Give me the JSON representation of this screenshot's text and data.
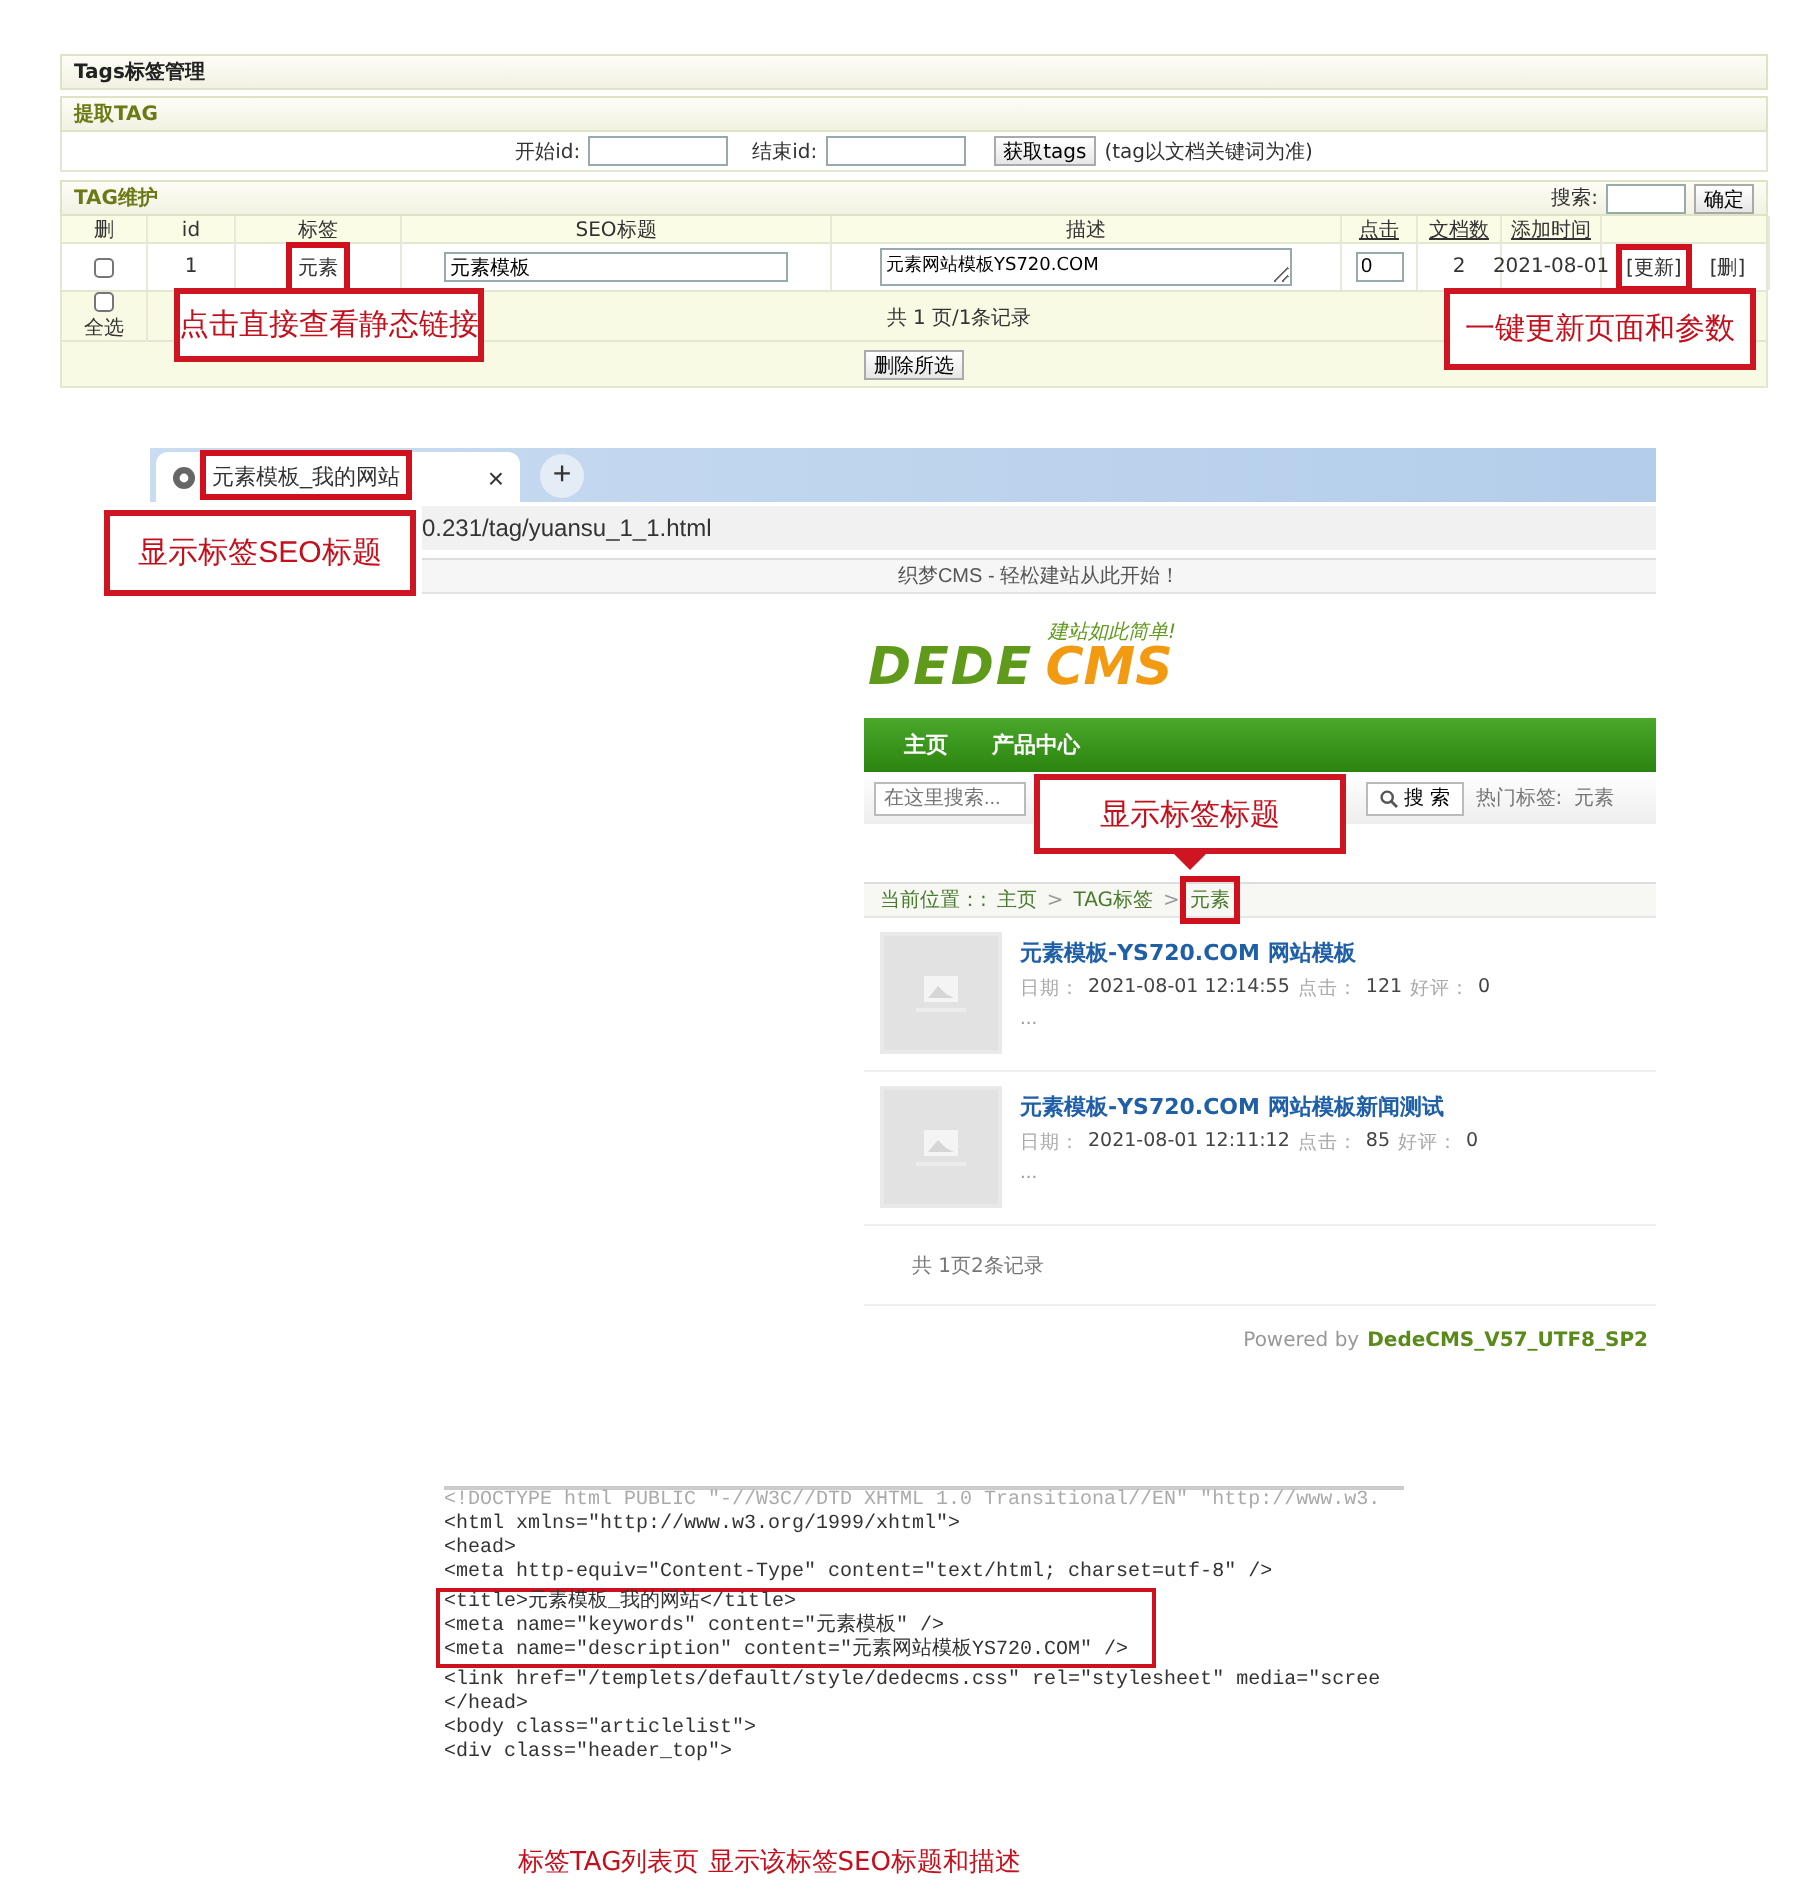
{
  "admin": {
    "title": "Tags标签管理",
    "extract": {
      "title": "提取TAG",
      "start_label": "开始id:",
      "end_label": "结束id:",
      "button": "获取tags",
      "note": "(tag以文档关键词为准)"
    },
    "maintain": {
      "title": "TAG维护",
      "search_label": "搜索:",
      "search_button": "确定",
      "columns": [
        {
          "label": "删",
          "link": false
        },
        {
          "label": "id",
          "link": false
        },
        {
          "label": "标签",
          "link": false
        },
        {
          "label": "SEO标题",
          "link": false
        },
        {
          "label": "描述",
          "link": false
        },
        {
          "label": "点击",
          "link": true
        },
        {
          "label": "文档数",
          "link": true
        },
        {
          "label": "添加时间",
          "link": true
        }
      ],
      "rows": [
        {
          "checked": false,
          "id": "1",
          "tag": "元素",
          "seo_title": "元素模板",
          "description": "元素网站模板YS720.COM",
          "clicks": "0",
          "docs": "2",
          "date": "2021-08-01",
          "update": "[更新]",
          "delete": "[删]"
        }
      ],
      "select_all": {
        "label": "全选",
        "checked": false
      },
      "pager": "共 1 页/1条记录",
      "delete_selected": "删除所选"
    },
    "callouts": [
      "点击直接查看静态链接",
      "一键更新页面和参数"
    ]
  },
  "browser": {
    "tab_title": "元素模板_我的网站",
    "close": "×",
    "new_tab": "+",
    "address": "0.231/tag/yuansu_1_1.html",
    "banner": "织梦CMS - 轻松建站从此开始！",
    "callout": "显示标签SEO标题"
  },
  "site": {
    "logo": {
      "dede": "DEDE",
      "cms": "CMS",
      "slogan": "建站如此简单!"
    },
    "nav": [
      {
        "label": "主页"
      },
      {
        "label": "产品中心"
      }
    ],
    "search": {
      "placeholder": "在这里搜索...",
      "button": "搜 索",
      "hot_label": "热门标签:",
      "hot_tag": "元素"
    },
    "callout": "显示标签标题",
    "breadcrumb": {
      "label": "当前位置：:",
      "items": [
        {
          "text": "主页"
        },
        {
          "sep": ">",
          "text": "TAG标签"
        },
        {
          "sep": ">",
          "text": "元素"
        }
      ]
    },
    "articles": [
      {
        "title": "元素模板-YS720.COM 网站模板",
        "date_label": "日期：",
        "date": "2021-08-01 12:14:55",
        "clicks_label": "点击：",
        "clicks": "121",
        "rating_label": "好评：",
        "rating": "0",
        "summary": "..."
      },
      {
        "title": "元素模板-YS720.COM 网站模板新闻测试",
        "date_label": "日期：",
        "date": "2021-08-01 12:11:12",
        "clicks_label": "点击：",
        "clicks": "85",
        "rating_label": "好评：",
        "rating": "0",
        "summary": "..."
      }
    ],
    "pager": "共 1页2条记录",
    "powered_label": "Powered by",
    "powered_name": "DedeCMS_V57_UTF8_SP2"
  },
  "source": {
    "lines": [
      {
        "text": "<!DOCTYPE html PUBLIC \"-//W3C//DTD XHTML 1.0 Transitional//EN\" \"http://www.w3.",
        "faded": true
      },
      {
        "text": "<html xmlns=\"http://www.w3.org/1999/xhtml\">",
        "faded": false
      },
      {
        "text": "<head>",
        "faded": false
      },
      {
        "text": "<meta http-equiv=\"Content-Type\" content=\"text/html; charset=utf-8\" />",
        "faded": false
      },
      {
        "text": "<title>元素模板_我的网站</title>",
        "faded": false
      },
      {
        "text": "<meta name=\"keywords\" content=\"元素模板\" />",
        "faded": false
      },
      {
        "text": "<meta name=\"description\" content=\"元素网站模板YS720.COM\" />",
        "faded": false
      },
      {
        "text": "<link href=\"/templets/default/style/dedecms.css\" rel=\"stylesheet\" media=\"scree",
        "faded": false
      },
      {
        "text": "</head>",
        "faded": false
      },
      {
        "text": "<body class=\"articlelist\">",
        "faded": false
      },
      {
        "text": "<div class=\"header_top\">",
        "faded": false
      }
    ]
  },
  "caption": "标签TAG列表页 显示该标签SEO标题和描述"
}
